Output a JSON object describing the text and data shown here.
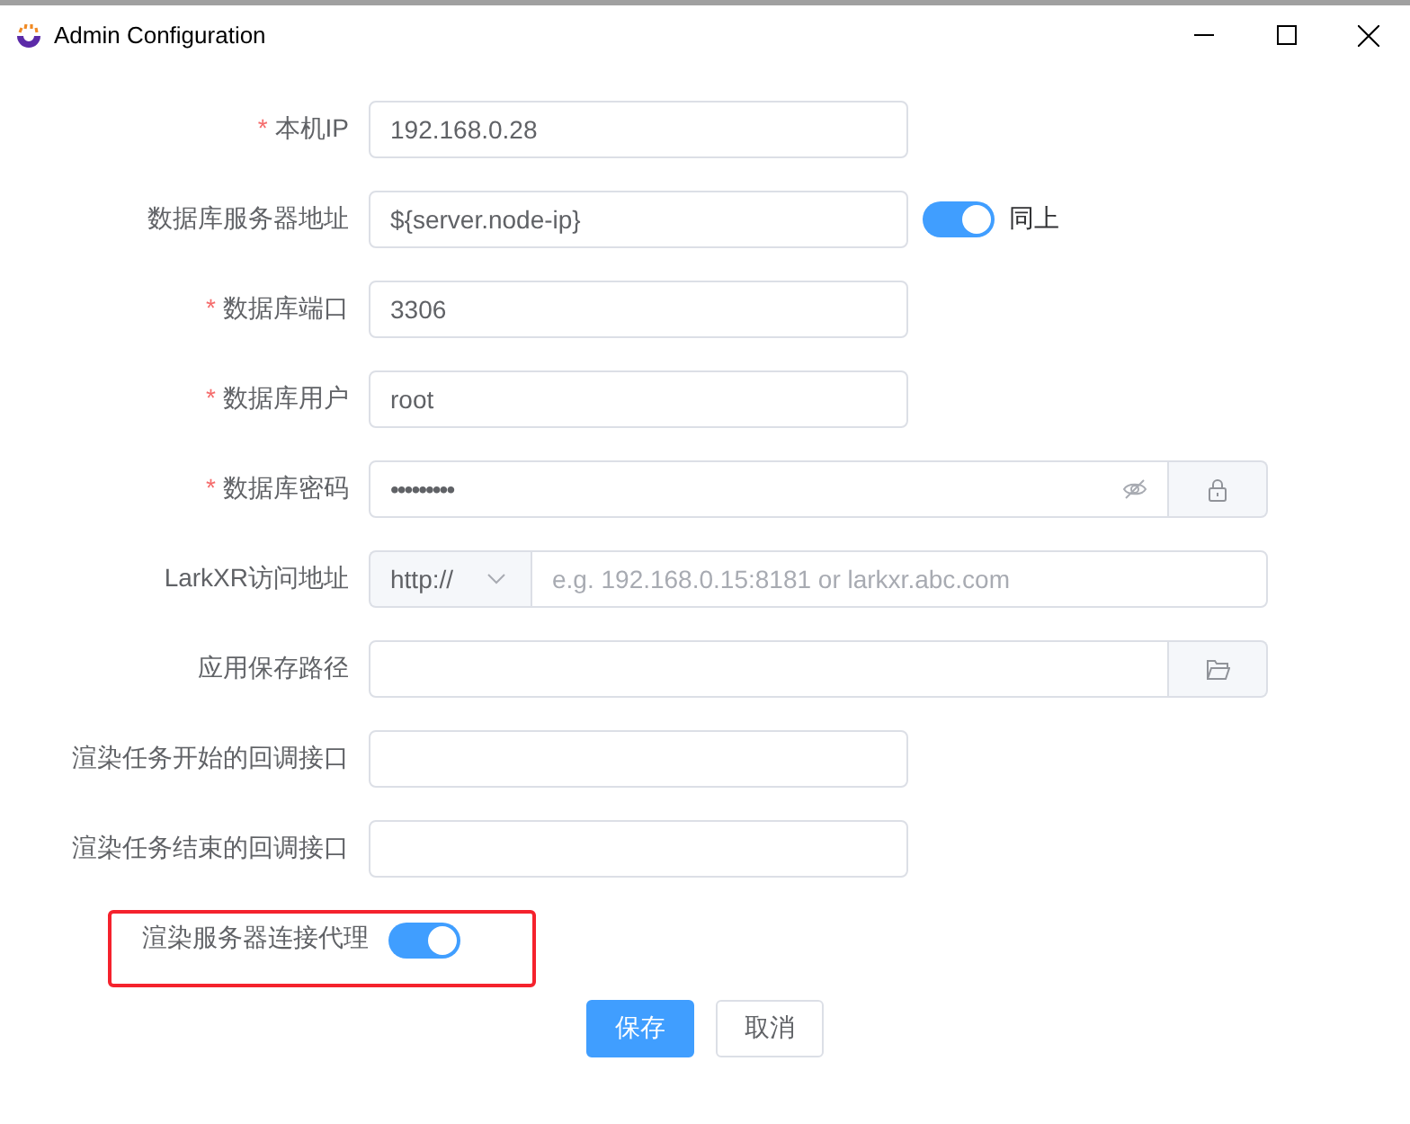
{
  "window": {
    "title": "Admin Configuration"
  },
  "fields": [
    {
      "kind": "text",
      "mark": "*",
      "label": "本机IP",
      "value": "192.168.0.28"
    },
    {
      "kind": "text_toggle",
      "label": "数据库服务器地址",
      "value": "${server.node-ip}",
      "toggle": {
        "on": true,
        "label": "同上"
      }
    },
    {
      "kind": "text",
      "mark": "*",
      "label": "数据库端口",
      "value": "3306"
    },
    {
      "kind": "text",
      "mark": "*",
      "label": "数据库用户",
      "value": "root"
    },
    {
      "kind": "password",
      "mark": "*",
      "label": "数据库密码",
      "value": "•••••••••"
    },
    {
      "kind": "url",
      "label": "LarkXR访问地址",
      "protocol": "http://",
      "placeholder": "e.g. 192.168.0.15:8181 or larkxr.abc.com"
    },
    {
      "kind": "path",
      "label": "应用保存路径"
    },
    {
      "kind": "text",
      "label": "渲染任务开始的回调接口"
    },
    {
      "kind": "text",
      "label": "渲染任务结束的回调接口"
    }
  ],
  "proxy": {
    "label": "渲染服务器连接代理",
    "on": true,
    "highlighted": true
  },
  "buttons": [
    {
      "label": "保存",
      "primary": true
    },
    {
      "label": "取消",
      "primary": false
    }
  ]
}
